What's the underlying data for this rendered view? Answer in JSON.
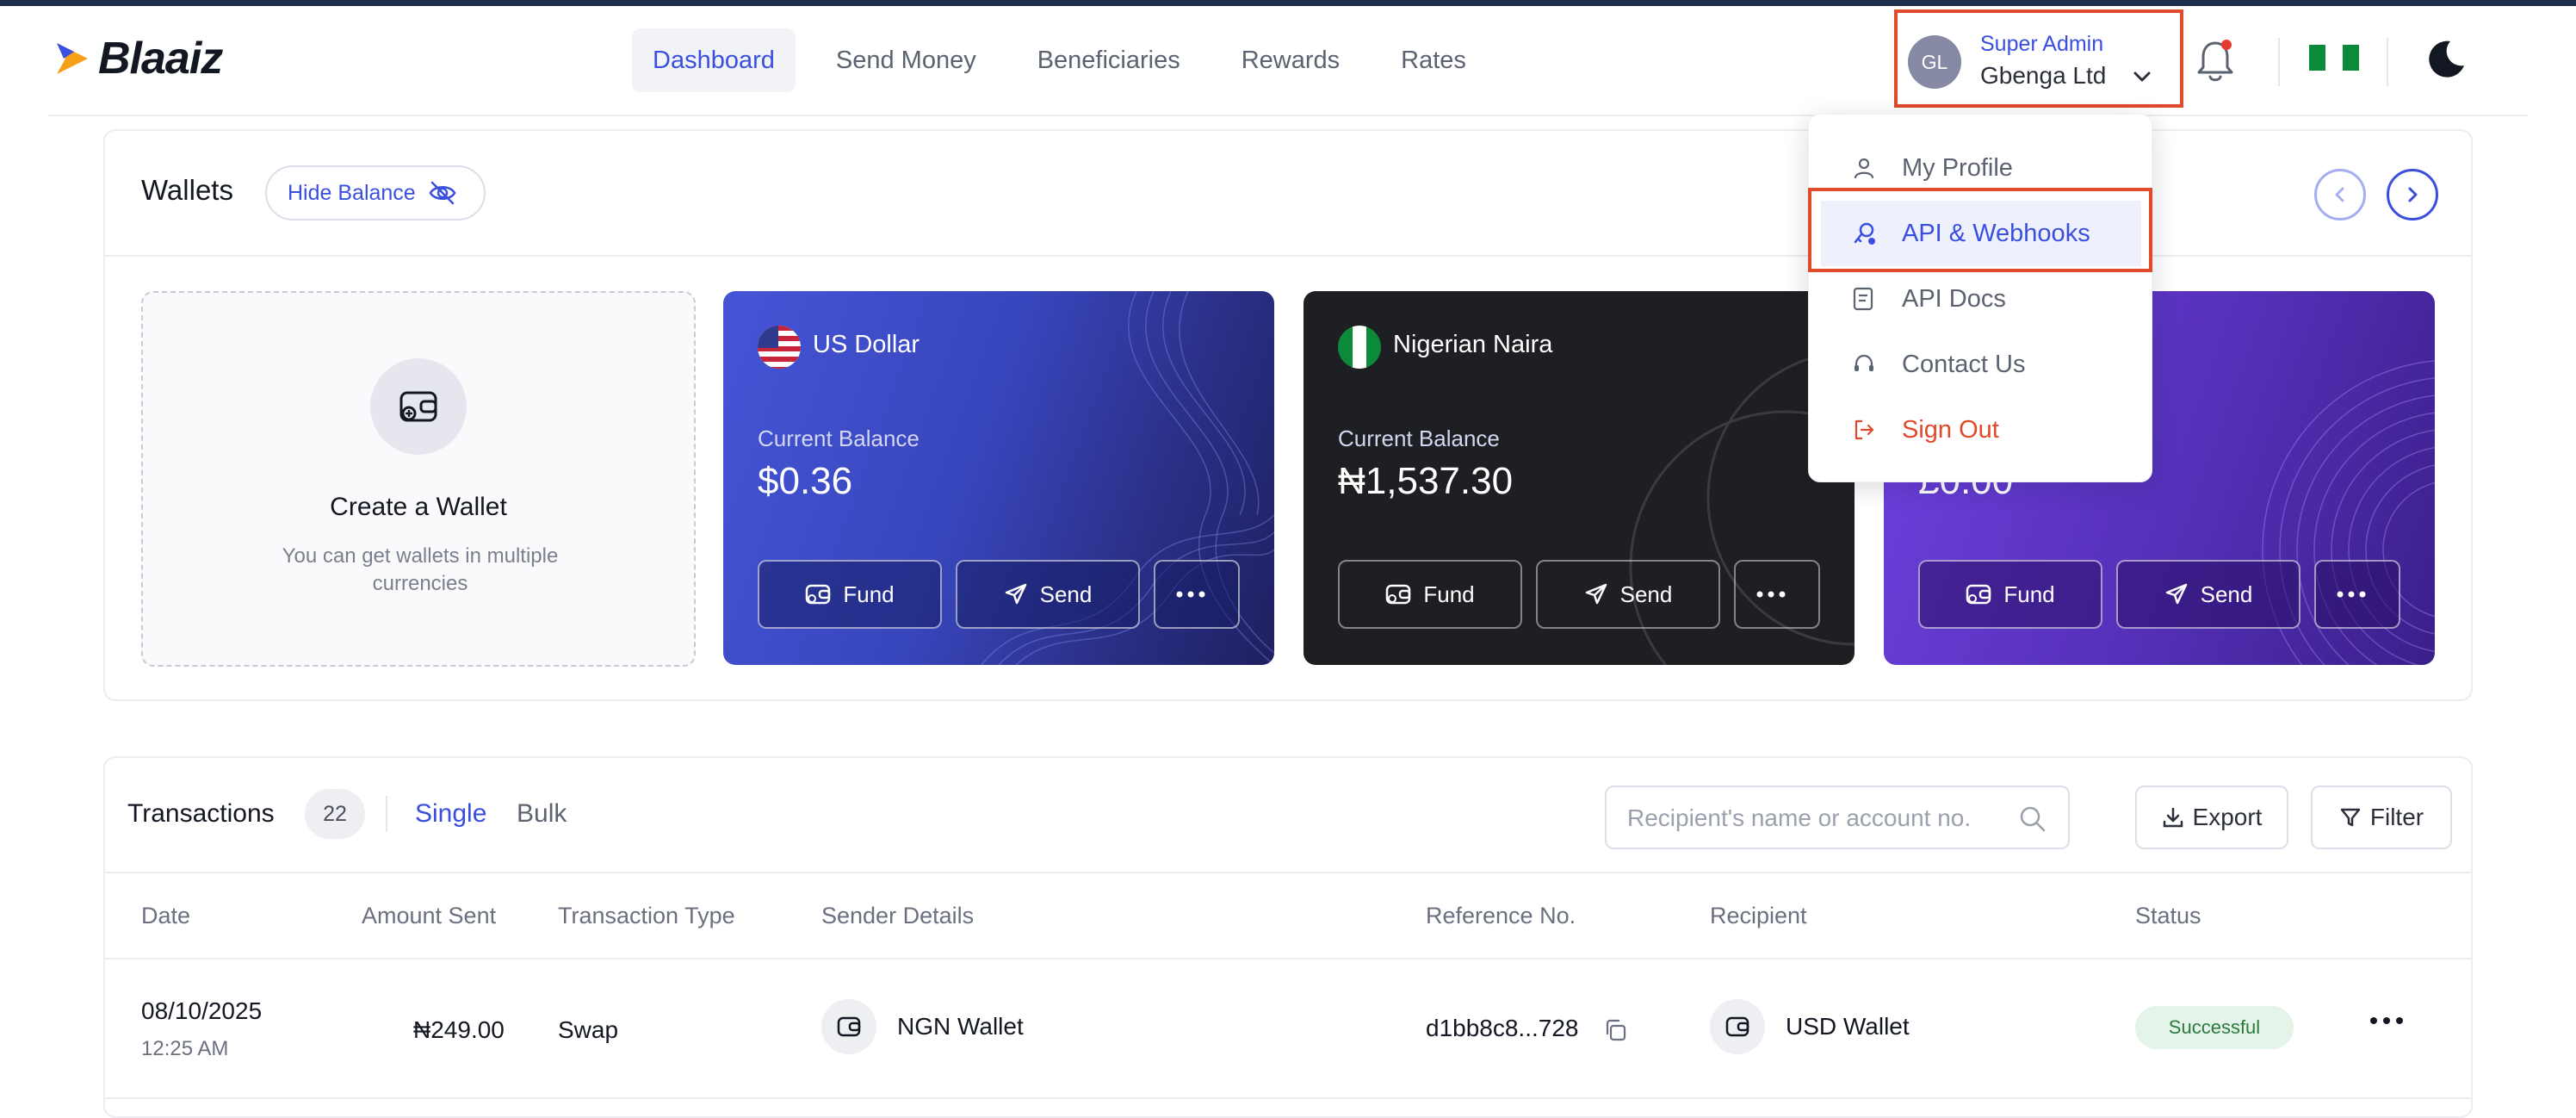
{
  "app": {
    "logo": "Blaaiz",
    "accent": "#3a4fe0",
    "highlight_color": "#e04a2b"
  },
  "nav": {
    "items": [
      {
        "label": "Dashboard",
        "active": true
      },
      {
        "label": "Send Money"
      },
      {
        "label": "Beneficiaries"
      },
      {
        "label": "Rewards"
      },
      {
        "label": "Rates"
      }
    ]
  },
  "user": {
    "initials": "GL",
    "role": "Super Admin",
    "company": "Gbenga Ltd"
  },
  "icons": {
    "notifications": "bell-icon",
    "theme": "moon-icon",
    "country": "nigeria-flag-icon"
  },
  "profile_menu": {
    "items": [
      {
        "label": "My Profile",
        "icon": "user-icon"
      },
      {
        "label": "API & Webhooks",
        "icon": "api-icon",
        "active": true
      },
      {
        "label": "API Docs",
        "icon": "document-icon"
      },
      {
        "label": "Contact Us",
        "icon": "headset-icon"
      },
      {
        "label": "Sign Out",
        "icon": "sign-out-icon"
      }
    ]
  },
  "wallets": {
    "title": "Wallets",
    "hide_balance": "Hide Balance",
    "create": {
      "title": "Create a Wallet",
      "subtitle": "You can get wallets in multiple currencies"
    },
    "cards": [
      {
        "currency": "US Dollar",
        "balance_label": "Current Balance",
        "balance": "$0.36",
        "fund": "Fund",
        "send": "Send"
      },
      {
        "currency": "Nigerian Naira",
        "balance_label": "Current Balance",
        "balance": "₦1,537.30",
        "fund": "Fund",
        "send": "Send"
      },
      {
        "currency": "",
        "balance_label": "",
        "balance": "£0.00",
        "fund": "Fund",
        "send": "Send"
      }
    ]
  },
  "transactions": {
    "title": "Transactions",
    "count": "22",
    "tabs": {
      "single": "Single",
      "bulk": "Bulk"
    },
    "search_placeholder": "Recipient's name or account no.",
    "export": "Export",
    "filter": "Filter",
    "columns": [
      "Date",
      "Amount Sent",
      "Transaction Type",
      "Sender Details",
      "Reference No.",
      "Recipient",
      "Status"
    ],
    "rows": [
      {
        "date": "08/10/2025",
        "time": "12:25 AM",
        "amount": "₦249.00",
        "type": "Swap",
        "sender": "NGN Wallet",
        "reference": "d1bb8c8...728",
        "recipient": "USD Wallet",
        "status": "Successful"
      }
    ]
  }
}
